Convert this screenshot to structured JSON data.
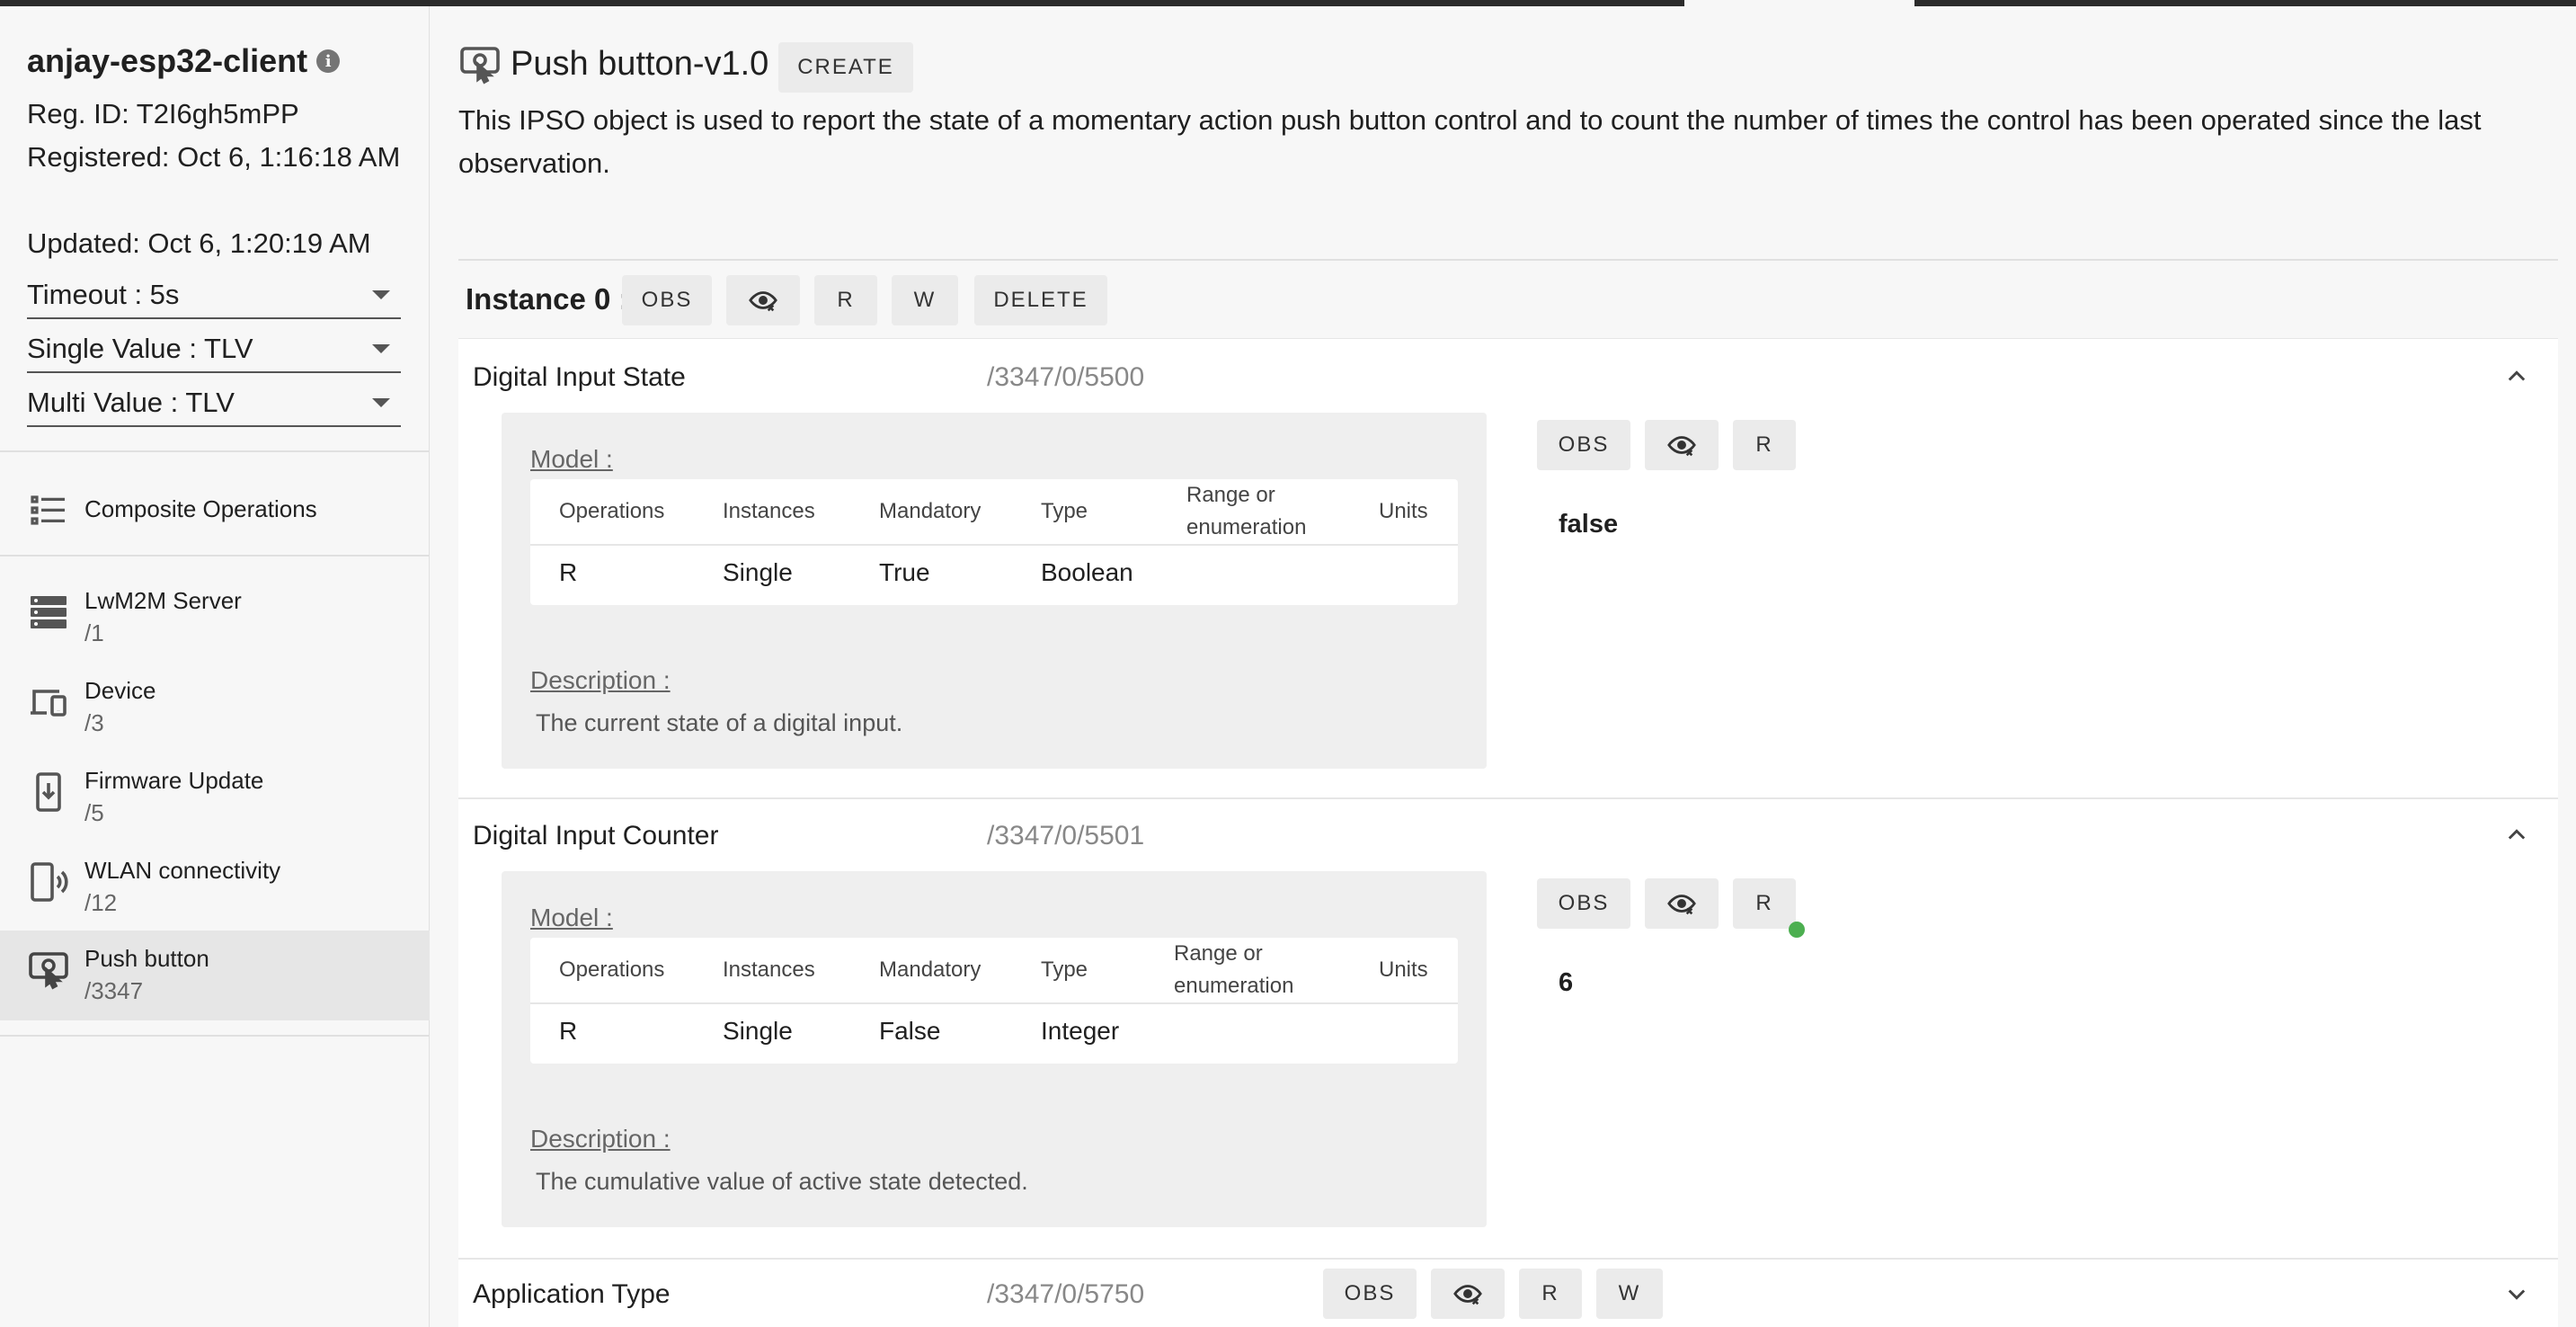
{
  "client": {
    "name": "anjay-esp32-client",
    "reg_id": "Reg. ID: T2I6gh5mPP",
    "registered": "Registered: Oct 6, 1:16:18 AM",
    "updated": "Updated: Oct 6, 1:20:19 AM"
  },
  "settings": {
    "timeout": "Timeout : 5s",
    "single_value": "Single Value : TLV",
    "multi_value": "Multi Value : TLV"
  },
  "sidebar": {
    "composite": "Composite Operations",
    "items": [
      {
        "label": "LwM2M Server",
        "path": "/1",
        "icon": "server-icon"
      },
      {
        "label": "Device",
        "path": "/3",
        "icon": "devices-icon"
      },
      {
        "label": "Firmware Update",
        "path": "/5",
        "icon": "phone-download-icon"
      },
      {
        "label": "WLAN connectivity",
        "path": "/12",
        "icon": "phone-wifi-icon"
      },
      {
        "label": "Push button",
        "path": "/3347",
        "icon": "touch-app-icon",
        "active": true
      }
    ]
  },
  "object": {
    "title": "Push button-v1.0",
    "create_label": "CREATE",
    "description": "This IPSO object is used to report the state of a momentary action push button control and to count the number of times the control has been operated since the last observation."
  },
  "instance": {
    "label": "Instance 0 :",
    "buttons": {
      "obs": "OBS",
      "r": "R",
      "w": "W",
      "delete": "DELETE"
    }
  },
  "labels": {
    "model": "Model :",
    "description": "Description :",
    "headers": [
      "Operations",
      "Instances",
      "Mandatory",
      "Type",
      "Range or enumeration",
      "Units"
    ],
    "obs": "OBS",
    "r": "R",
    "w": "W"
  },
  "resources": [
    {
      "name": "Digital Input State",
      "path": "/3347/0/5500",
      "row": [
        "R",
        "Single",
        "True",
        "Boolean",
        "",
        ""
      ],
      "description": "The current state of a digital input.",
      "value": "false",
      "expanded": true
    },
    {
      "name": "Digital Input Counter",
      "path": "/3347/0/5501",
      "row": [
        "R",
        "Single",
        "False",
        "Integer",
        "",
        ""
      ],
      "description": "The cumulative value of active state detected.",
      "value": "6",
      "expanded": true,
      "observing": true
    },
    {
      "name": "Application Type",
      "path": "/3347/0/5750",
      "expanded": false
    }
  ],
  "colors": {
    "observe_indicator": "#4caf50",
    "background": "#f7f7f7"
  }
}
